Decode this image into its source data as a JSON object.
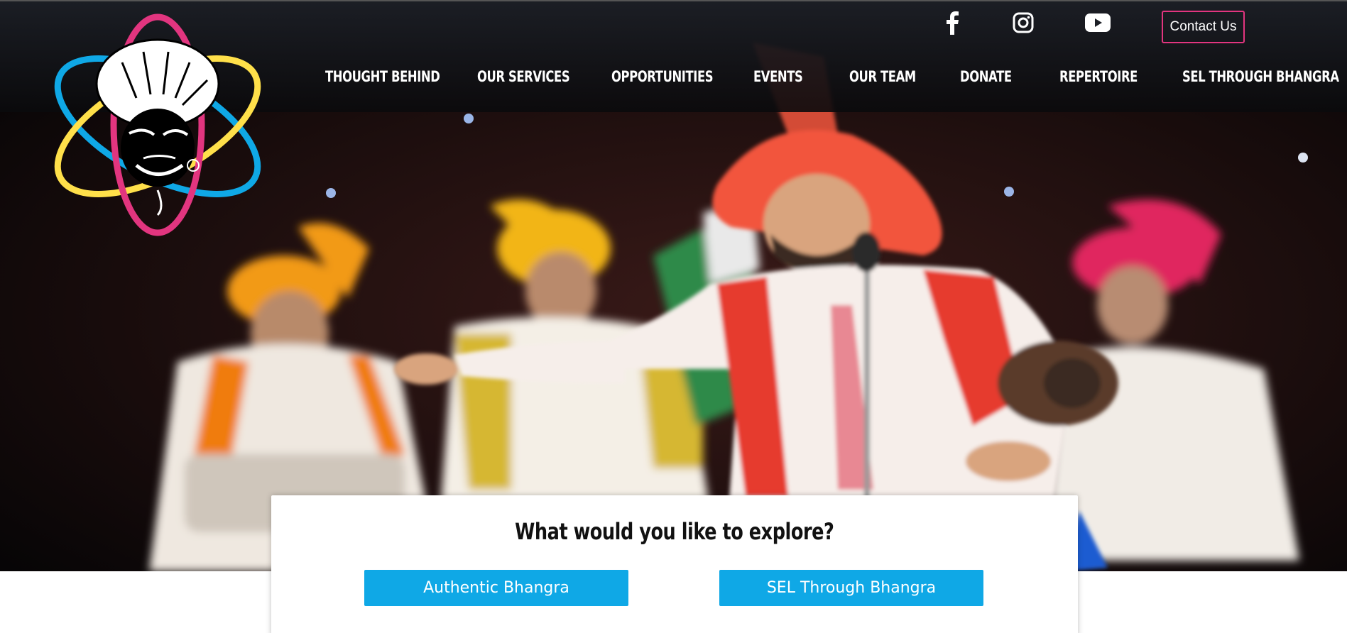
{
  "colors": {
    "accent_pink": "#e2357f",
    "accent_blue": "#0fa8e6",
    "accent_yellow": "#ffe04a",
    "header_bg": "#1c1f26"
  },
  "header": {
    "logo_icon": "bhangra-dancer-logo-icon",
    "social": [
      {
        "name": "facebook",
        "icon": "facebook-icon"
      },
      {
        "name": "instagram",
        "icon": "instagram-icon"
      },
      {
        "name": "youtube",
        "icon": "youtube-icon"
      }
    ],
    "contact_label": "Contact Us"
  },
  "nav": {
    "items": [
      {
        "label": "THOUGHT BEHIND"
      },
      {
        "label": "OUR SERVICES"
      },
      {
        "label": "OPPORTUNITIES"
      },
      {
        "label": "EVENTS"
      },
      {
        "label": "OUR TEAM"
      },
      {
        "label": "DONATE"
      },
      {
        "label": "REPERTOIRE"
      },
      {
        "label": "SEL THROUGH BHANGRA"
      }
    ]
  },
  "hero": {
    "image_icon": "bhangra-performers-hero-image"
  },
  "explore": {
    "title": "What would you like to explore?",
    "buttons": [
      {
        "label": "Authentic Bhangra"
      },
      {
        "label": "SEL Through Bhangra"
      }
    ]
  }
}
